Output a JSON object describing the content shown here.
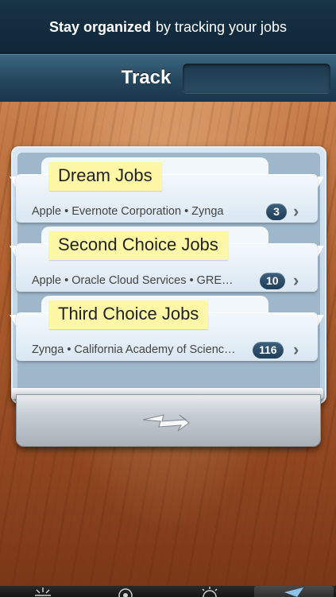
{
  "banner": {
    "strong": "Stay organized",
    "rest": "by tracking your jobs"
  },
  "navbar": {
    "title": "Track",
    "search_placeholder": ""
  },
  "folders": [
    {
      "label": "Dream Jobs",
      "companies": "Apple • Evernote Corporation • Zynga",
      "count": "3"
    },
    {
      "label": "Second Choice Jobs",
      "companies": "Apple • Oracle Cloud Services • GRE…",
      "count": "10"
    },
    {
      "label": "Third Choice Jobs",
      "companies": "Zynga • California Academy of Scienc…",
      "count": "116"
    }
  ],
  "tabbar": {
    "items": [
      {
        "icon": "sun-icon"
      },
      {
        "icon": "target-icon"
      },
      {
        "icon": "sunrise-icon"
      },
      {
        "icon": "paper-plane-icon",
        "active": true
      }
    ]
  }
}
